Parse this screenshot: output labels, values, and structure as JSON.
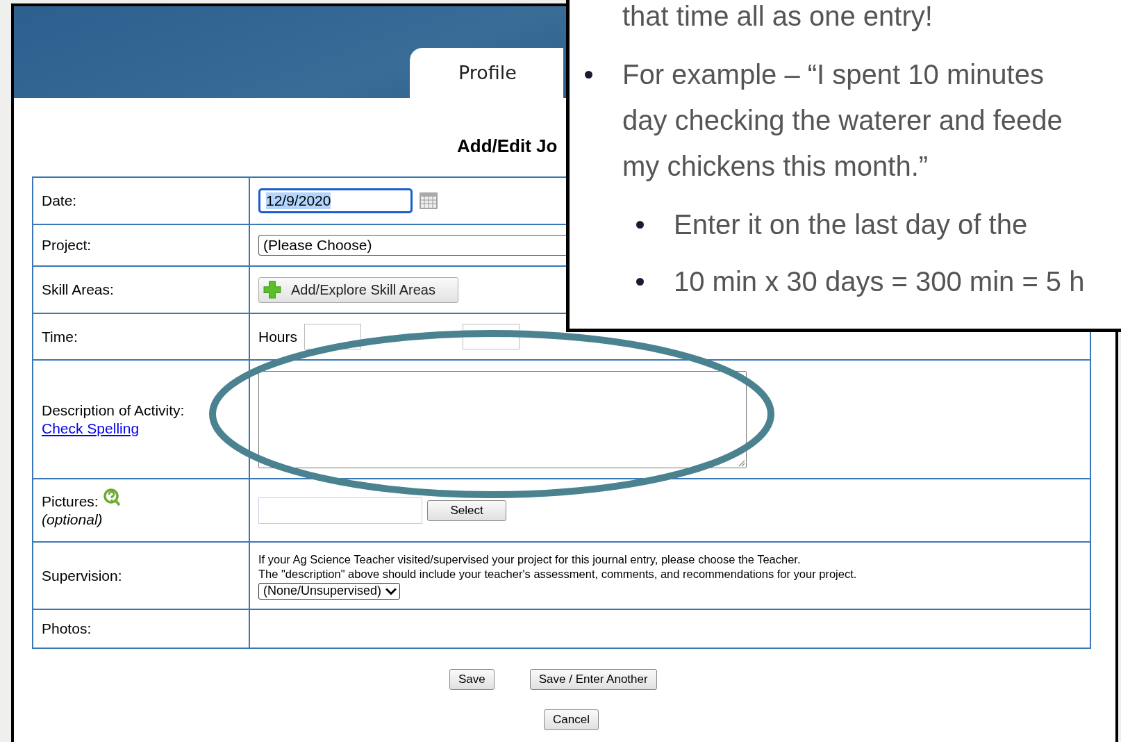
{
  "header": {
    "tab": "Profile"
  },
  "title": "Add/Edit Jo",
  "fields": [
    {
      "kind": "date",
      "label": "Date:",
      "value": "12/9/2020",
      "selected": true
    },
    {
      "kind": "select",
      "label": "Project:",
      "value": "(Please Choose)"
    },
    {
      "kind": "button",
      "label": "Skill Areas:",
      "button": "Add/Explore Skill Areas"
    },
    {
      "kind": "time",
      "label": "Time:",
      "hours_label": "Hours"
    },
    {
      "kind": "textarea",
      "label": "Description of Activity:",
      "link": "Check Spelling"
    },
    {
      "kind": "file",
      "label": "Pictures:",
      "note": "(optional)",
      "button": "Select"
    },
    {
      "kind": "supervision",
      "label": "Supervision:",
      "lines": [
        "If your Ag Science Teacher visited/supervised your project for this journal entry, please choose the Teacher.",
        "The \"description\" above should include your teacher's assessment, comments, and recommendations for your project."
      ],
      "value": "(None/Unsupervised)"
    },
    {
      "kind": "empty",
      "label": "Photos:"
    }
  ],
  "buttons": [
    "Save",
    "Save / Enter Another"
  ],
  "cancel": "Cancel",
  "callout": {
    "continuation": "that time all as one entry!",
    "items": [
      {
        "lines": [
          "For example – “I spent 10 minutes",
          "day checking the waterer and feede",
          "my chickens this month.”"
        ],
        "children": [
          {
            "text": "Enter it on the last day of the"
          },
          {
            "text": "10 min x 30 days = 300 min = 5 h"
          }
        ]
      }
    ]
  }
}
